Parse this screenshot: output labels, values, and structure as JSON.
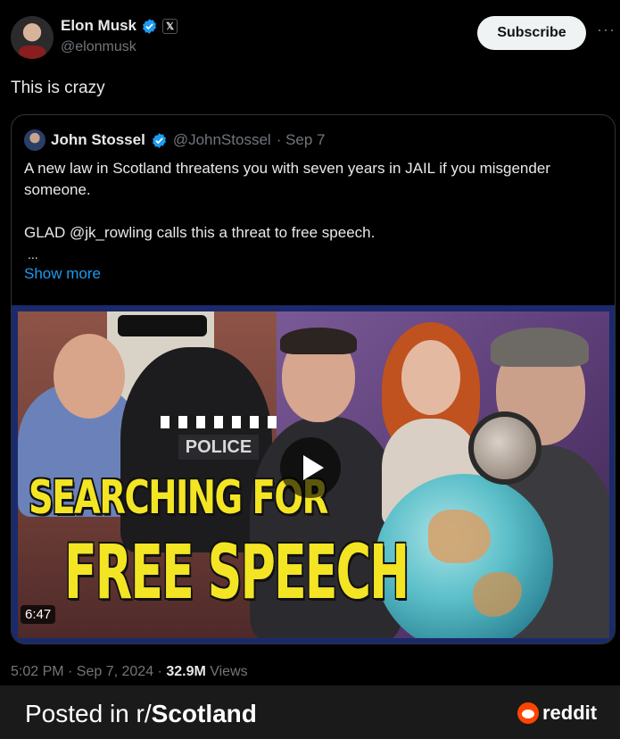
{
  "tweet": {
    "author_name": "Elon Musk",
    "author_handle": "@elonmusk",
    "x_badge": "𝕏",
    "subscribe_label": "Subscribe",
    "more_glyph": "···",
    "text": "This is crazy",
    "timestamp": "5:02 PM · Sep 7, 2024 · ",
    "views_count": "32.9M",
    "views_label": " Views"
  },
  "quoted": {
    "author_name": "John Stossel",
    "author_handle": "@JohnStossel",
    "date": "· Sep 7",
    "paragraph1": "A new law in Scotland threatens you with seven years in JAIL if you misgender someone.",
    "paragraph2": "GLAD @jk_rowling calls this a threat to free speech.",
    "ellipsis": "...",
    "show_more": "Show more",
    "video": {
      "thumbnail_line1": "SEARCHING FOR",
      "thumbnail_line2": "FREE SPEECH",
      "badge_text": "POLICE",
      "duration": "6:47"
    }
  },
  "footer": {
    "posted_in": "Posted in r/",
    "subreddit": "Scotland",
    "brand": "reddit"
  },
  "colors": {
    "background": "#000000",
    "verified": "#1d9bf0",
    "link": "#1d9bf0",
    "headline": "#f3e524",
    "reddit": "#ff4500"
  },
  "icons": [
    "verified-badge-icon",
    "x-logo-icon",
    "more-icon",
    "play-icon",
    "reddit-logo-icon"
  ]
}
